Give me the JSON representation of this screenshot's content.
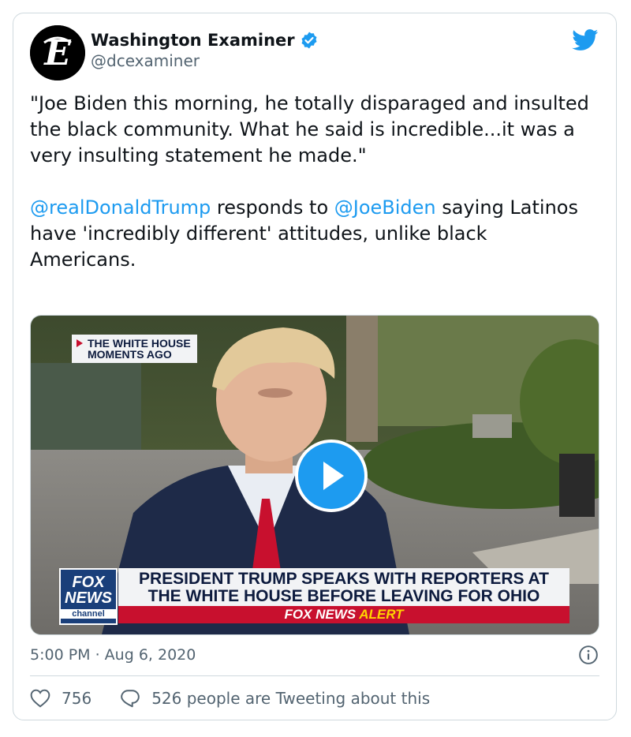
{
  "author": {
    "name": "Washington Examiner",
    "handle": "@dcexaminer",
    "avatar_icon": "washington-examiner-logo",
    "verified_icon": "verified-badge-icon"
  },
  "tweet": {
    "quote": "\"Joe Biden this morning, he totally disparaged and insulted the black community. What he said is incredible...it was a very insulting statement he made.\"",
    "mention_trump": "@realDonaldTrump",
    "responds_to": " responds to ",
    "mention_biden": "@JoeBiden",
    "rest": " saying Latinos have 'incredibly different' attitudes, unlike black Americans."
  },
  "video": {
    "locator_line1": "THE WHITE HOUSE",
    "locator_line2": "MOMENTS AGO",
    "banner_line1": "PRESIDENT TRUMP SPEAKS WITH REPORTERS AT",
    "banner_line2": "THE WHITE HOUSE BEFORE LEAVING FOR OHIO",
    "alert_brand": "FOX NEWS",
    "alert_word": "ALERT",
    "logo_line1": "FOX",
    "logo_line2": "NEWS",
    "logo_line3": "channel",
    "play_icon": "play-icon"
  },
  "meta": {
    "timestamp": "5:00 PM · Aug 6, 2020",
    "info_icon": "info-icon"
  },
  "stats": {
    "likes": "756",
    "replies_text": "526 people are Tweeting about this"
  },
  "colors": {
    "accent": "#1d9bf0",
    "text": "#0f1419",
    "muted": "#536471",
    "fox_red": "#c8102e",
    "fox_blue": "#1a3f7a"
  }
}
